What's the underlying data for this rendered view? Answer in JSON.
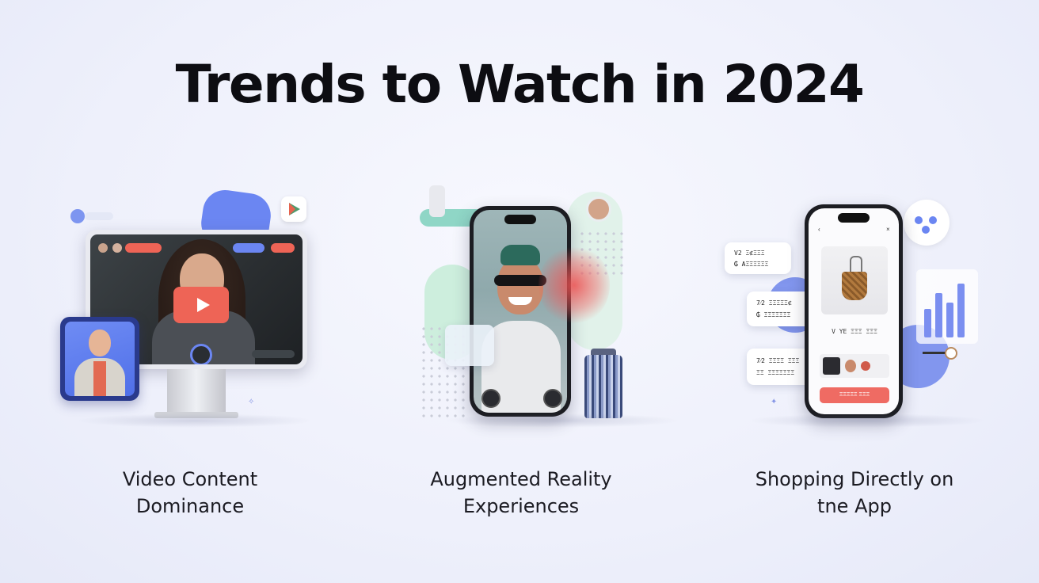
{
  "title": "Trends to Watch in 2024",
  "trends": [
    {
      "caption_line1": "Video Content",
      "caption_line2": "Dominance",
      "icon": "video-monitor-illustration"
    },
    {
      "caption_line1": "Augmented Reality",
      "caption_line2": "Experiences",
      "icon": "ar-phone-illustration"
    },
    {
      "caption_line1": "Shopping Directly on",
      "caption_line2": "tne App",
      "icon": "shopping-phone-illustration"
    }
  ],
  "shopping": {
    "bubble1_line1": "V2 Ξ⊄ΞΞΞ",
    "bubble1_line2": "₲ ΑΞΞΞΞΞΞ",
    "bubble2_line1": "7⁄2 ΞΞΞΞΞ⊄",
    "bubble2_line2": "₲ ΞΞΞΞΞΞΞ",
    "bubble3_line1": "7⁄2 ΞΞΞΞ ΞΞΞ",
    "bubble3_line2": "ΞΞ ΞΞΞΞΞΞΞ",
    "product_line": "V YE ΞΞΞ ΞΞΞ",
    "buy_label": "ΞΞΞΞΞ ΞΞΞ"
  },
  "colors": {
    "accent_blue": "#6b86f2",
    "accent_red": "#ee6456",
    "mint": "#cdeedd"
  }
}
